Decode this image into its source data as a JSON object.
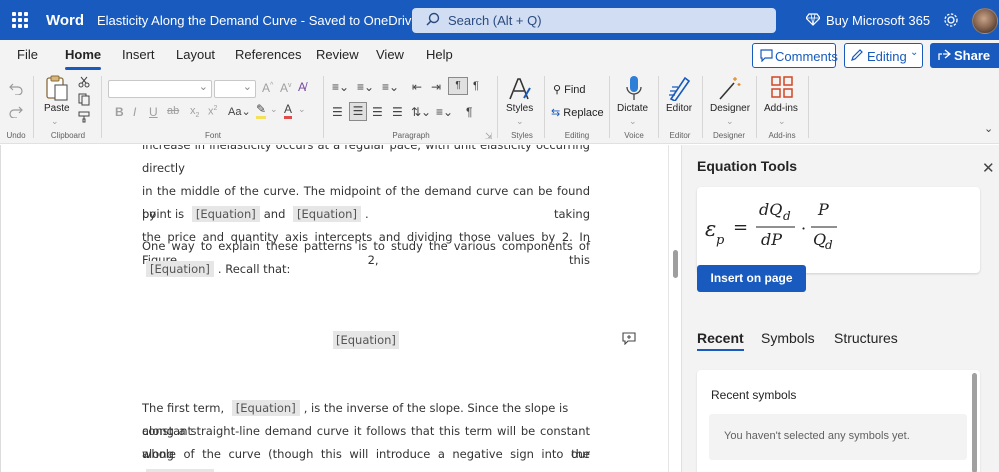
{
  "titlebar": {
    "app_name": "Word",
    "document_title": "Elasticity Along the Demand Curve",
    "save_status": "Saved to OneDrive",
    "search_placeholder": "Search (Alt + Q)",
    "buy_label": "Buy Microsoft 365"
  },
  "menu": {
    "tabs": [
      "File",
      "Home",
      "Insert",
      "Layout",
      "References",
      "Review",
      "View",
      "Help"
    ],
    "active_tab": "Home",
    "comments_label": "Comments",
    "editing_label": "Editing",
    "share_label": "Share"
  },
  "ribbon": {
    "undo_group": "Undo",
    "clipboard_group": "Clipboard",
    "paste_label": "Paste",
    "font_group": "Font",
    "paragraph_group": "Paragraph",
    "styles_group": "Styles",
    "styles_label": "Styles",
    "editing_group": "Editing",
    "find_label": "Find",
    "replace_label": "Replace",
    "voice_group": "Voice",
    "dictate_label": "Dictate",
    "editor_group": "Editor",
    "editor_label": "Editor",
    "designer_group": "Designer",
    "designer_label": "Designer",
    "addins_group": "Add-ins",
    "addins_label": "Add-ins"
  },
  "document": {
    "p1_cut": "increase in inelasticity occurs at a regular pace, with unit elasticity occurring directly",
    "p1_line2": "in the middle of the curve. The midpoint of the demand curve can be found by taking",
    "p1_line3": "the price and quantity axis intercepts and dividing those values by 2. In Figure 2, this",
    "p1_line4_a": "point is",
    "p1_line4_b": "and",
    "p1_line4_c": ".",
    "p2_line1": "One way to explain these patterns is to study the various components of",
    "p2_line2_b": ". Recall that:",
    "p3_line1_a": "The first term,",
    "p3_line1_b": ", is the inverse of the slope. Since the slope is constant",
    "p3_line2": "along a straight-line demand curve it follows that this term will be constant along the",
    "p3_line3": "whole of the curve (though this will introduce a negative sign into our",
    "equation_placeholder": "[Equation]"
  },
  "pane": {
    "title": "Equation Tools",
    "insert_label": "Insert on page",
    "tabs": [
      "Recent",
      "Symbols",
      "Structures"
    ],
    "active_tab": "Recent",
    "recent_heading": "Recent symbols",
    "recent_empty": "You haven't selected any symbols yet.",
    "formula": {
      "epsilon": "ε",
      "epsilon_sub": "p",
      "equals": "=",
      "num1": "dQ",
      "num1_sub": "d",
      "den1": "dP",
      "dot": "·",
      "num2": "P",
      "den2": "Q",
      "den2_sub": "d"
    }
  },
  "colors": {
    "brand_blue": "#185abd",
    "ribbon_bg": "#f3f3f3",
    "equation_highlight": "#e6e6e6"
  }
}
